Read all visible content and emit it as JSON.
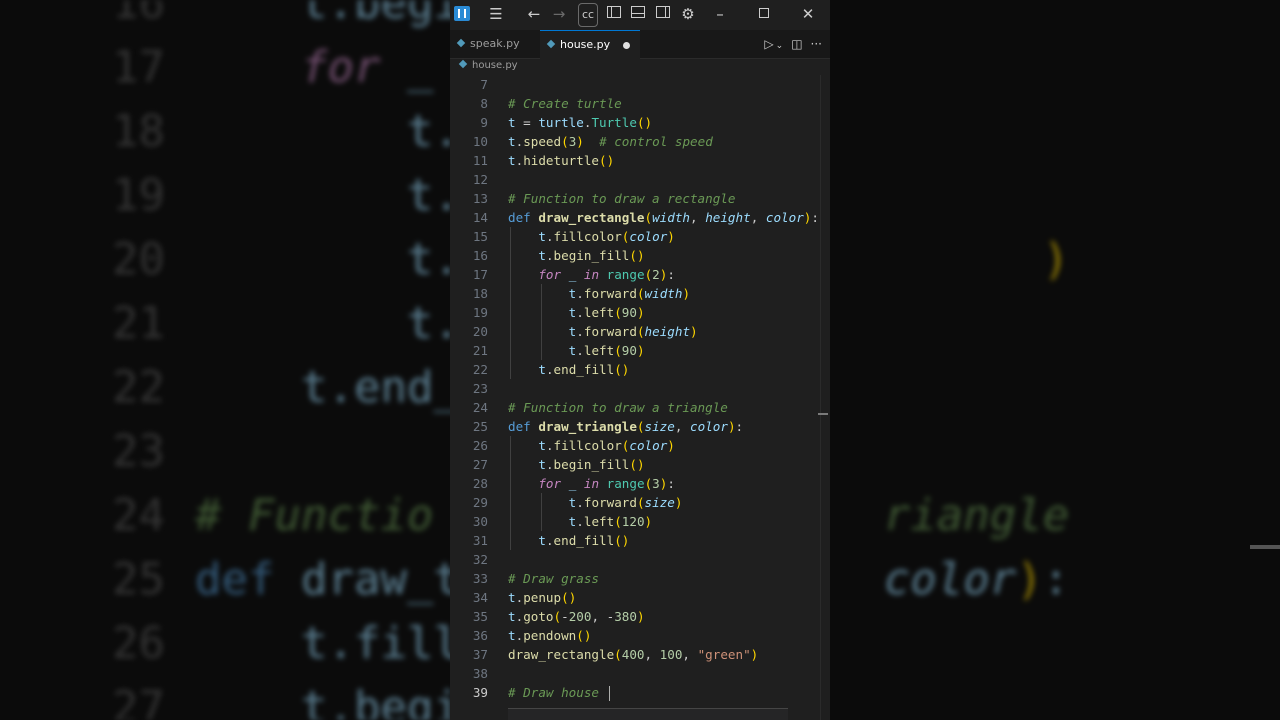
{
  "window": {
    "cc_label": "cc"
  },
  "tabs": [
    {
      "label": "speak.py",
      "active": false
    },
    {
      "label": "house.py",
      "active": true,
      "unsaved": true
    }
  ],
  "breadcrumb": "house.py",
  "colors": {
    "accent": "#0078d4",
    "editor_bg": "#1f1f1f",
    "comment": "#6a9955",
    "keyword": "#569cd6",
    "function": "#dcdcaa",
    "string": "#ce9178",
    "number": "#b5cea8"
  },
  "icons": {
    "menu": "hamburger-icon",
    "back": "arrow-left-icon",
    "forward": "arrow-right-icon",
    "layout": "layout-icons",
    "settings": "gear-icon",
    "minimize": "minimize-icon",
    "maximize": "maximize-icon",
    "close": "close-icon",
    "run": "play-icon",
    "split": "split-editor-icon",
    "more": "ellipsis-icon"
  },
  "code_lines": [
    {
      "n": "7",
      "text": ""
    },
    {
      "n": "8",
      "text": "# Create turtle"
    },
    {
      "n": "9",
      "text": "t = turtle.Turtle()"
    },
    {
      "n": "10",
      "text": "t.speed(3)  # control speed"
    },
    {
      "n": "11",
      "text": "t.hideturtle()"
    },
    {
      "n": "12",
      "text": ""
    },
    {
      "n": "13",
      "text": "# Function to draw a rectangle"
    },
    {
      "n": "14",
      "text": "def draw_rectangle(width, height, color):"
    },
    {
      "n": "15",
      "text": "    t.fillcolor(color)"
    },
    {
      "n": "16",
      "text": "    t.begin_fill()"
    },
    {
      "n": "17",
      "text": "    for _ in range(2):"
    },
    {
      "n": "18",
      "text": "        t.forward(width)"
    },
    {
      "n": "19",
      "text": "        t.left(90)"
    },
    {
      "n": "20",
      "text": "        t.forward(height)"
    },
    {
      "n": "21",
      "text": "        t.left(90)"
    },
    {
      "n": "22",
      "text": "    t.end_fill()"
    },
    {
      "n": "23",
      "text": ""
    },
    {
      "n": "24",
      "text": "# Function to draw a triangle"
    },
    {
      "n": "25",
      "text": "def draw_triangle(size, color):"
    },
    {
      "n": "26",
      "text": "    t.fillcolor(color)"
    },
    {
      "n": "27",
      "text": "    t.begin_fill()"
    },
    {
      "n": "28",
      "text": "    for _ in range(3):"
    },
    {
      "n": "29",
      "text": "        t.forward(size)"
    },
    {
      "n": "30",
      "text": "        t.left(120)"
    },
    {
      "n": "31",
      "text": "    t.end_fill()"
    },
    {
      "n": "32",
      "text": ""
    },
    {
      "n": "33",
      "text": "# Draw grass"
    },
    {
      "n": "34",
      "text": "t.penup()"
    },
    {
      "n": "35",
      "text": "t.goto(-200, -380)"
    },
    {
      "n": "36",
      "text": "t.pendown()"
    },
    {
      "n": "37",
      "text": "draw_rectangle(400, 100, \"green\")"
    },
    {
      "n": "38",
      "text": ""
    },
    {
      "n": "39",
      "text": "# Draw house ",
      "cursor": true
    }
  ],
  "background_zoom": [
    {
      "n": "16",
      "text": "    t.begi"
    },
    {
      "n": "17",
      "text": "    for _"
    },
    {
      "n": "18",
      "text": "        t."
    },
    {
      "n": "19",
      "text": "        t."
    },
    {
      "n": "20",
      "text": "        t.                      )"
    },
    {
      "n": "21",
      "text": "        t."
    },
    {
      "n": "22",
      "text": "    t.end_"
    },
    {
      "n": "23",
      "text": ""
    },
    {
      "n": "24",
      "text": "# Functio                 riangle"
    },
    {
      "n": "25",
      "text": "def draw_t                color):"
    },
    {
      "n": "26",
      "text": "    t.fill"
    },
    {
      "n": "27",
      "text": "    t.begi"
    }
  ]
}
